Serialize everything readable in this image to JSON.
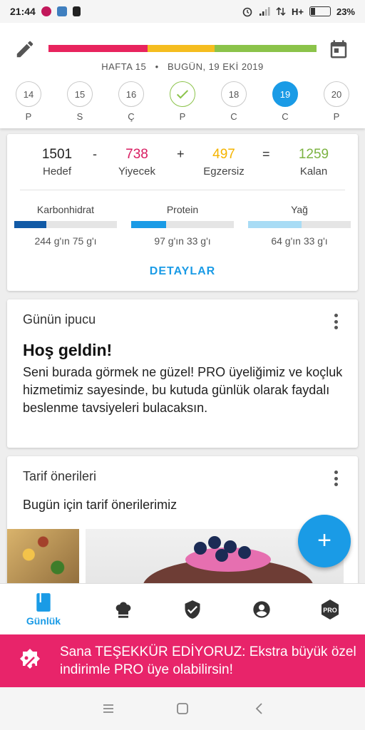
{
  "status_bar": {
    "time": "21:44",
    "network": "H+",
    "battery": "23%"
  },
  "header": {
    "week_label": "HAFTA 15",
    "separator": "•",
    "date_label": "BUGÜN, 19 EKİ 2019",
    "progress_segments": [
      {
        "color": "#e8245e",
        "fraction": 0.37
      },
      {
        "color": "#f5bd1f",
        "fraction": 0.25
      },
      {
        "color": "#8bc34a",
        "fraction": 0.38
      }
    ]
  },
  "days": [
    {
      "num": "14",
      "label": "P"
    },
    {
      "num": "15",
      "label": "S"
    },
    {
      "num": "16",
      "label": "Ç"
    },
    {
      "num": "",
      "label": "P",
      "state": "done"
    },
    {
      "num": "18",
      "label": "C"
    },
    {
      "num": "19",
      "label": "C",
      "state": "today"
    },
    {
      "num": "20",
      "label": "P"
    }
  ],
  "summary": {
    "goal": {
      "value": "1501",
      "label": "Hedef"
    },
    "minus": "-",
    "food": {
      "value": "738",
      "label": "Yiyecek",
      "color": "#d81b60"
    },
    "plus": "+",
    "exercise": {
      "value": "497",
      "label": "Egzersiz",
      "color": "#f5b400"
    },
    "equals": "=",
    "remaining": {
      "value": "1259",
      "label": "Kalan",
      "color": "#7cb342"
    },
    "macros": [
      {
        "name": "Karbonhidrat",
        "value": "244 g'ın 75 g'ı",
        "fraction": 0.31,
        "color": "#115aa6"
      },
      {
        "name": "Protein",
        "value": "97 g'ın 33 g'ı",
        "fraction": 0.34,
        "color": "#1a9be6"
      },
      {
        "name": "Yağ",
        "value": "64 g'ın 33 g'ı",
        "fraction": 0.52,
        "color": "#a8dcf5"
      }
    ],
    "details_label": "DETAYLAR"
  },
  "tip_card": {
    "title": "Günün ipucu",
    "headline": "Hoş geldin!",
    "body": "Seni burada görmek ne güzel! PRO üyeliğimiz ve koçluk hizmetimiz sayesinde, bu kutuda günlük olarak faydalı beslenme tavsiyeleri bulacaksın."
  },
  "recipe_card": {
    "title": "Tarif önerileri",
    "subtitle": "Bugün için tarif önerilerimiz"
  },
  "fab": {
    "label": "+"
  },
  "bottom_nav": {
    "items": [
      {
        "label": "Günlük",
        "icon": "diary-icon",
        "active": true
      },
      {
        "label": "",
        "icon": "chef-hat-icon"
      },
      {
        "label": "",
        "icon": "shield-check-icon"
      },
      {
        "label": "",
        "icon": "account-icon"
      },
      {
        "label": "",
        "icon": "pro-badge-icon",
        "badge_text": "PRO"
      }
    ]
  },
  "promo": {
    "text": "Sana TEŞEKKÜR EDİYORUZ: Ekstra büyük özel indirimle PRO üye olabilirsin!",
    "color": "#e8246a"
  },
  "colors": {
    "accent": "#1a9be6"
  }
}
